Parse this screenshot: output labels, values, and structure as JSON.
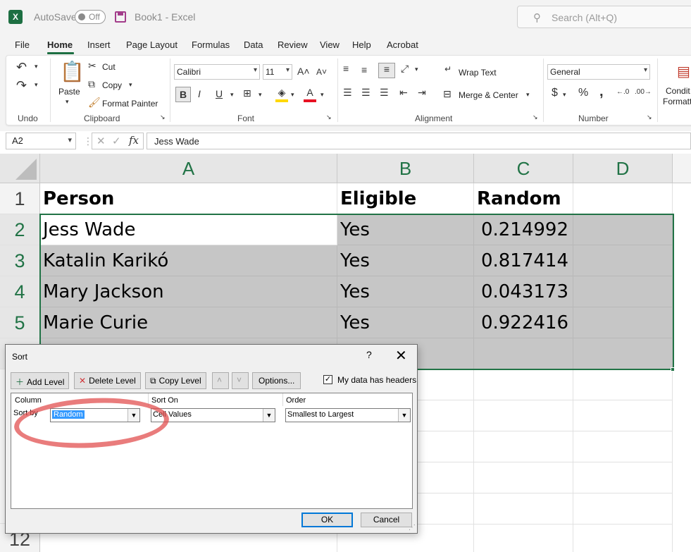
{
  "titlebar": {
    "app_icon": "excel-logo-icon",
    "autosave_label": "AutoSave",
    "autosave_state": "Off",
    "document_title": "Book1  -  Excel",
    "search_placeholder": "Search (Alt+Q)"
  },
  "menu": {
    "tabs": [
      "File",
      "Home",
      "Insert",
      "Page Layout",
      "Formulas",
      "Data",
      "Review",
      "View",
      "Help",
      "Acrobat"
    ],
    "active": "Home"
  },
  "ribbon": {
    "undo_group": "Undo",
    "clipboard": {
      "paste": "Paste",
      "cut": "Cut",
      "copy": "Copy",
      "format_painter": "Format Painter",
      "label": "Clipboard"
    },
    "font": {
      "name": "Calibri",
      "size": "11",
      "bold": "B",
      "italic": "I",
      "underline": "U",
      "label": "Font"
    },
    "alignment": {
      "wrap_text": "Wrap Text",
      "merge_center": "Merge & Center",
      "label": "Alignment"
    },
    "number": {
      "format": "General",
      "currency": "$",
      "percent": "%",
      "comma": ",",
      "label": "Number"
    },
    "styles": {
      "conditional_formatting_1": "Condit",
      "conditional_formatting_2": "Formatt"
    }
  },
  "formula_bar": {
    "name_box": "A2",
    "fx": "fx",
    "content": "Jess Wade"
  },
  "sheet": {
    "columns": [
      "A",
      "B",
      "C",
      "D"
    ],
    "rows": [
      "1",
      "2",
      "3",
      "4",
      "5",
      "12"
    ],
    "data": [
      [
        "Person",
        "Eligible",
        "Random"
      ],
      [
        "Jess Wade",
        "Yes",
        "0.214992"
      ],
      [
        "Katalin Karikó",
        "Yes",
        "0.817414"
      ],
      [
        "Mary Jackson",
        "Yes",
        "0.043173"
      ],
      [
        "Marie Curie",
        "Yes",
        "0.922416"
      ]
    ]
  },
  "sort_dialog": {
    "title": "Sort",
    "help": "?",
    "close": "✕",
    "add_level": "Add Level",
    "delete_level": "Delete Level",
    "copy_level": "Copy Level",
    "options": "Options...",
    "headers_checkbox_label": "My data has headers",
    "headers_checked": true,
    "column_header": "Column",
    "sort_on_header": "Sort On",
    "order_header": "Order",
    "sort_by_label": "Sort by",
    "sort_by_value": "Random",
    "sort_on_value": "Cell Values",
    "order_value": "Smallest to Largest",
    "ok": "OK",
    "cancel": "Cancel",
    "annotation_color": "#e25050"
  },
  "colors": {
    "excel_green": "#217346",
    "selection_fill": "#c6c6c6",
    "accent_blue": "#0078d7"
  }
}
